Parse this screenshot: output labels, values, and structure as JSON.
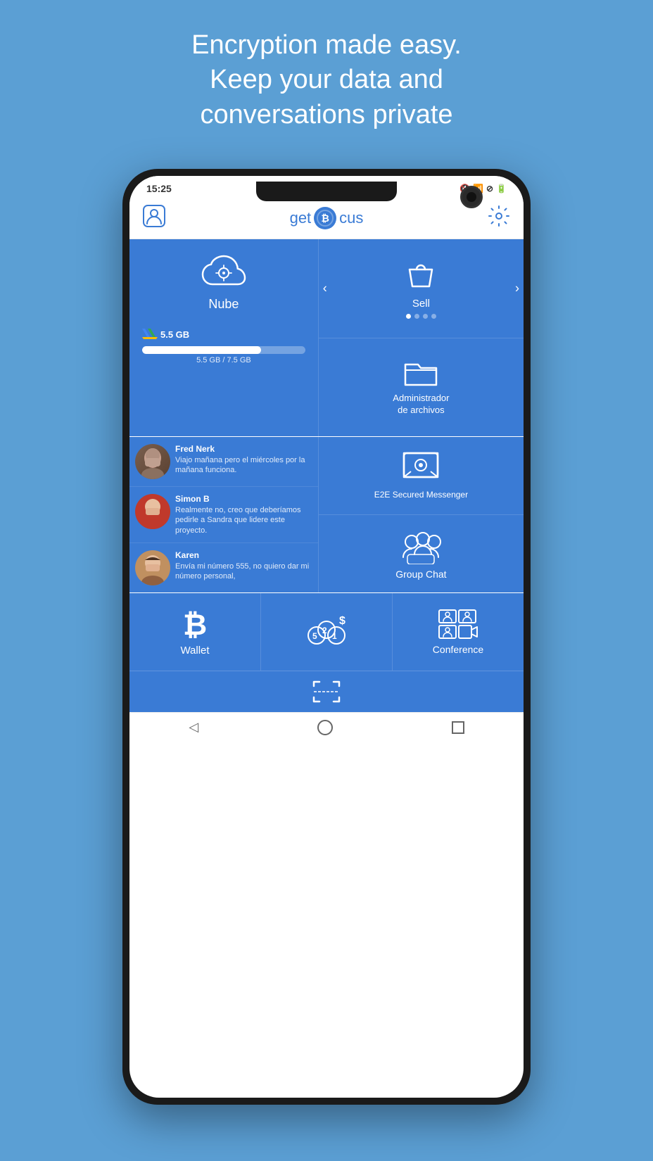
{
  "page": {
    "background_color": "#5b9fd4",
    "header_line1": "Encryption made easy.",
    "header_line2": "Keep your data and",
    "header_line3": "conversations private"
  },
  "status_bar": {
    "time": "15:25",
    "icons": "🔇 📶 🔔 🔋"
  },
  "app_header": {
    "logo_text": "get",
    "logo_middle": "ocus",
    "profile_icon": "user-icon",
    "settings_icon": "gear-icon"
  },
  "grid": {
    "nube": {
      "label": "Nube",
      "storage_used": "5.5 GB",
      "storage_total": "7.5 GB",
      "storage_display": "5.5 GB / 7.5 GB",
      "storage_percent": 73
    },
    "sell": {
      "label": "Sell",
      "dots": 4
    },
    "file_manager": {
      "label_line1": "Administrador",
      "label_line2": "de archivos"
    },
    "messenger": {
      "label": "E2E Secured Messenger",
      "contacts": [
        {
          "name": "Fred Nerk",
          "message": "Viajo mañana pero el miércoles por la mañana funciona."
        },
        {
          "name": "Simon B",
          "message": "Realmente no, creo que deberíamos pedirle a Sandra que lidere este proyecto."
        },
        {
          "name": "Karen",
          "message": "Envía mi número 555, no quiero dar mi número personal,"
        }
      ]
    },
    "group_chat": {
      "label": "Group Chat"
    },
    "wallet": {
      "label": "Wallet"
    },
    "exchange": {
      "label": ""
    },
    "conference": {
      "label": "Conference"
    }
  },
  "nav": {
    "back": "◁",
    "home": "○",
    "recent": "□"
  }
}
